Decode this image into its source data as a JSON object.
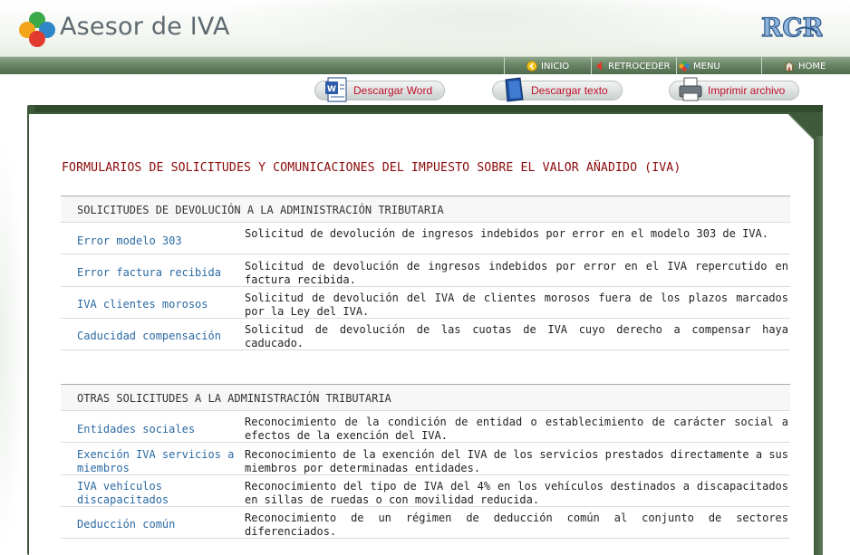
{
  "header": {
    "app_title": "Asesor de IVA",
    "logo_icon": "four-circles-logo-icon",
    "brand_icon": "rcr-brand-logo-icon",
    "brand_text": "RCR"
  },
  "nav": {
    "inicio": "INICIO",
    "retroceder": "RETROCEDER",
    "menu": "MENU",
    "home": "HOME"
  },
  "toolbar": {
    "word": "Descargar Word",
    "text": "Descargar texto",
    "print": "Imprimir archivo"
  },
  "document": {
    "title": "FORMULARIOS DE SOLICITUDES Y COMUNICACIONES DEL IMPUESTO SOBRE EL VALOR AÑADIDO (IVA)",
    "sections": [
      {
        "heading": "SOLICITUDES DE DEVOLUCIÓN A LA ADMINISTRACIÓN TRIBUTARIA",
        "rows": [
          {
            "link": "Error modelo 303",
            "desc": "Solicitud de devolución de ingresos indebidos por error en el modelo 303 de IVA."
          },
          {
            "link": "Error factura recibida",
            "desc": "Solicitud de devolución de ingresos indebidos por error en el IVA repercutido en factura recibida."
          },
          {
            "link": "IVA clientes morosos",
            "desc": "Solicitud de devolución del IVA de clientes morosos fuera de los plazos marcados por la Ley del IVA."
          },
          {
            "link": "Caducidad compensación",
            "desc": "Solicitud de devolución de las cuotas de IVA cuyo derecho a compensar haya caducado."
          }
        ]
      },
      {
        "heading": "OTRAS SOLICITUDES A LA ADMINISTRACIÓN TRIBUTARIA",
        "rows": [
          {
            "link": "Entidades sociales",
            "desc": "Reconocimiento de la condición de entidad o establecimiento de carácter social a efectos de la exención del IVA."
          },
          {
            "link": "Exención IVA servicios a miembros",
            "desc": "Reconocimiento de la exención del IVA de los servicios prestados directamente a sus miembros por determinadas entidades."
          },
          {
            "link": "IVA vehículos discapacitados",
            "desc": "Reconocimiento del tipo de IVA del 4% en los vehículos destinados a discapacitados en sillas de ruedas o con movilidad reducida."
          },
          {
            "link": "Deducción común",
            "desc": "Reconocimiento de un régimen de deducción común al conjunto de sectores diferenciados."
          }
        ]
      }
    ]
  },
  "colors": {
    "nav_green": "#5f7a5c",
    "frame_green": "#3d5a3a",
    "title_red": "#8b0a0a",
    "link_blue": "#2b6aa3",
    "button_text_red": "#c0102c"
  }
}
